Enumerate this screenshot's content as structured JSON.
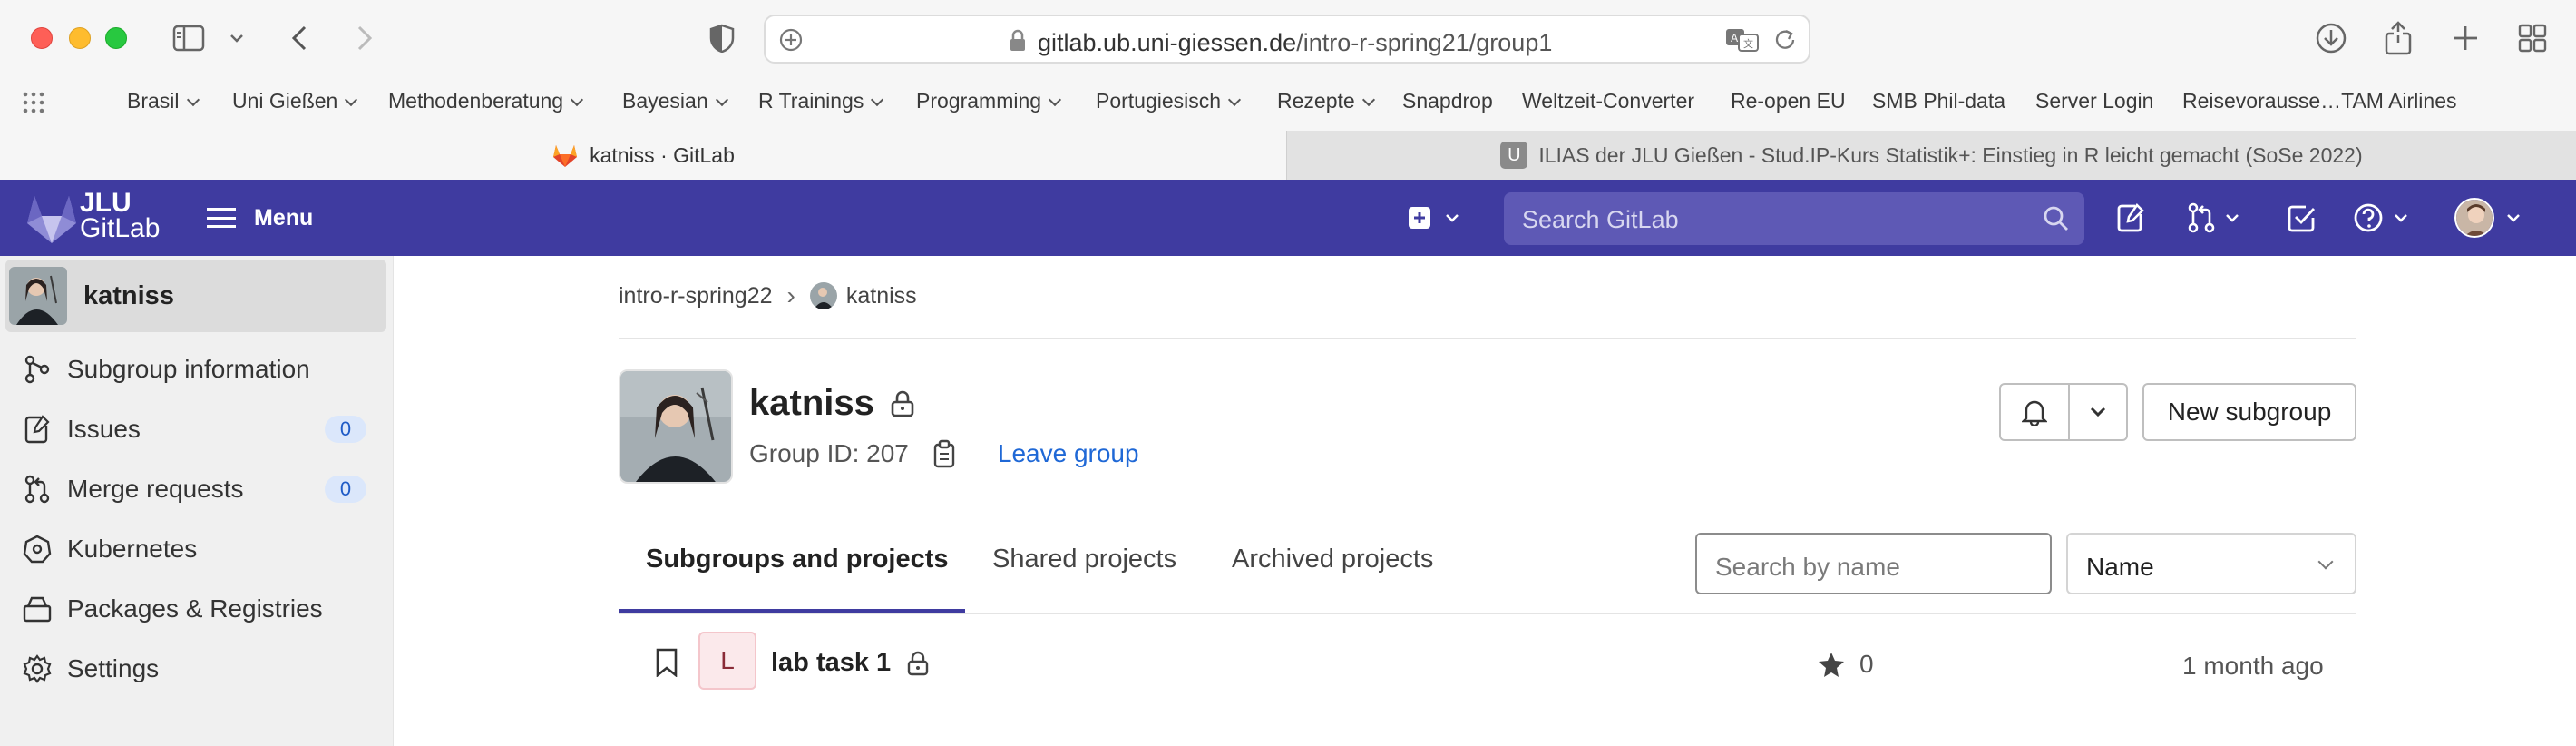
{
  "browser": {
    "url_domain": "gitlab.ub.uni-giessen.de",
    "url_path": "/intro-r-spring21/group1",
    "bookmarks": [
      {
        "label": "Brasil",
        "chevron": true
      },
      {
        "label": "Uni Gießen",
        "chevron": true
      },
      {
        "label": "Methodenberatung",
        "chevron": true
      },
      {
        "label": "Bayesian",
        "chevron": true
      },
      {
        "label": "R Trainings",
        "chevron": true
      },
      {
        "label": "Programming",
        "chevron": true
      },
      {
        "label": "Portugiesisch",
        "chevron": true
      },
      {
        "label": "Rezepte",
        "chevron": true
      },
      {
        "label": "Snapdrop",
        "chevron": false
      },
      {
        "label": "Weltzeit-Converter",
        "chevron": false
      },
      {
        "label": "Re-open EU",
        "chevron": false
      },
      {
        "label": "SMB Phil-data",
        "chevron": false
      },
      {
        "label": "Server Login",
        "chevron": false
      },
      {
        "label": "Reisevorausse…TAM Airlines",
        "chevron": false
      }
    ],
    "tabs": [
      {
        "label": "katniss · GitLab",
        "active": true
      },
      {
        "label": "ILIAS der JLU Gießen - Stud.IP-Kurs Statistik+: Einstieg in R leicht gemacht (SoSe 2022)",
        "active": false
      }
    ],
    "inactive_tab_badge": "U"
  },
  "header": {
    "logo_line1": "JLU",
    "logo_line2": "GitLab",
    "menu_label": "Menu",
    "search_placeholder": "Search GitLab"
  },
  "sidebar": {
    "group_name": "katniss",
    "items": [
      {
        "label": "Subgroup information",
        "icon": "subgroup-icon"
      },
      {
        "label": "Issues",
        "icon": "issues-icon",
        "badge": "0"
      },
      {
        "label": "Merge requests",
        "icon": "merge-request-icon",
        "badge": "0"
      },
      {
        "label": "Kubernetes",
        "icon": "kubernetes-icon"
      },
      {
        "label": "Packages & Registries",
        "icon": "package-icon"
      },
      {
        "label": "Settings",
        "icon": "gear-icon"
      }
    ]
  },
  "main": {
    "breadcrumb": {
      "parent": "intro-r-spring22",
      "current": "katniss"
    },
    "group": {
      "name": "katniss",
      "group_id": "Group ID: 207",
      "leave_label": "Leave group",
      "new_subgroup_label": "New subgroup"
    },
    "tabs": [
      {
        "label": "Subgroups and projects",
        "active": true
      },
      {
        "label": "Shared projects",
        "active": false
      },
      {
        "label": "Archived projects",
        "active": false
      }
    ],
    "search_placeholder": "Search by name",
    "sort_selected": "Name",
    "projects": [
      {
        "initial": "L",
        "name": "lab task 1",
        "stars": "0",
        "updated": "1 month ago"
      }
    ]
  },
  "colors": {
    "header_bg": "#3f3ba0",
    "link": "#1f68d6",
    "badge_bg": "#dbe7fb"
  }
}
